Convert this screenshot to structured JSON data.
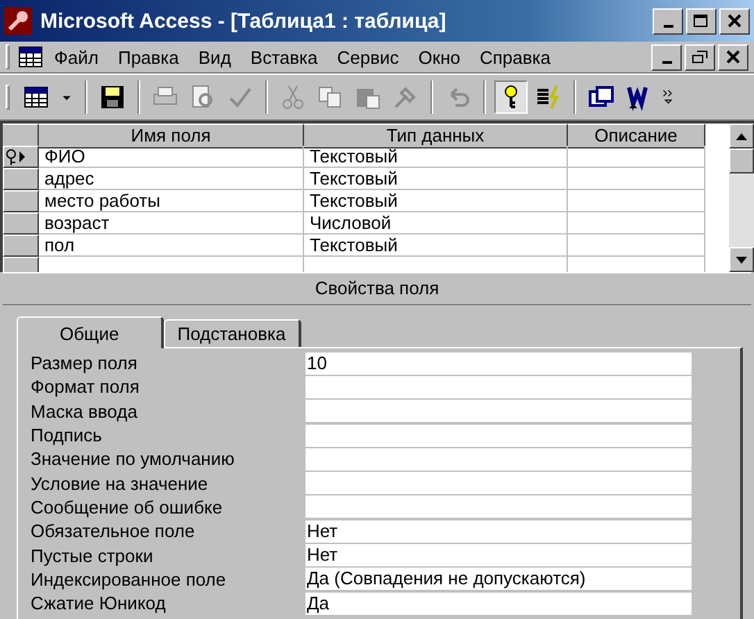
{
  "window": {
    "title": "Microsoft Access - [Таблица1 : таблица]"
  },
  "menu": [
    {
      "label": "Файл"
    },
    {
      "label": "Правка"
    },
    {
      "label": "Вид"
    },
    {
      "label": "Вставка"
    },
    {
      "label": "Сервис"
    },
    {
      "label": "Окно"
    },
    {
      "label": "Справка"
    }
  ],
  "toolbar": [
    {
      "kind": "view",
      "disabled": false,
      "pressed": false
    },
    {
      "kind": "dropdown",
      "disabled": false,
      "pressed": false
    },
    {
      "kind": "sep"
    },
    {
      "kind": "save",
      "disabled": false,
      "pressed": false
    },
    {
      "kind": "sep"
    },
    {
      "kind": "print",
      "disabled": true,
      "pressed": false
    },
    {
      "kind": "preview",
      "disabled": true,
      "pressed": false
    },
    {
      "kind": "spell",
      "disabled": true,
      "pressed": false
    },
    {
      "kind": "sep"
    },
    {
      "kind": "cut",
      "disabled": true,
      "pressed": false
    },
    {
      "kind": "copy",
      "disabled": true,
      "pressed": false
    },
    {
      "kind": "paste",
      "disabled": true,
      "pressed": false
    },
    {
      "kind": "painter",
      "disabled": true,
      "pressed": false
    },
    {
      "kind": "sep"
    },
    {
      "kind": "undo",
      "disabled": true,
      "pressed": false
    },
    {
      "kind": "sep"
    },
    {
      "kind": "key",
      "disabled": false,
      "pressed": true
    },
    {
      "kind": "indexes",
      "disabled": false,
      "pressed": false
    },
    {
      "kind": "sep"
    },
    {
      "kind": "newobject",
      "disabled": false,
      "pressed": false
    },
    {
      "kind": "word",
      "disabled": false,
      "pressed": false
    },
    {
      "kind": "more",
      "disabled": false,
      "pressed": false
    }
  ],
  "table": {
    "columns": [
      "Имя поля",
      "Тип данных",
      "Описание"
    ],
    "rows": [
      {
        "name": "ФИО",
        "type": "Текстовый",
        "key": true,
        "current": true
      },
      {
        "name": "адрес",
        "type": "Текстовый",
        "key": false,
        "current": false
      },
      {
        "name": "место работы",
        "type": "Текстовый",
        "key": false,
        "current": false
      },
      {
        "name": "возраст",
        "type": "Числовой",
        "key": false,
        "current": false
      },
      {
        "name": "пол",
        "type": "Текстовый",
        "key": false,
        "current": false
      }
    ]
  },
  "properties": {
    "title": "Свойства поля",
    "tabs": [
      {
        "label": "Общие",
        "selected": true
      },
      {
        "label": "Подстановка",
        "selected": false
      }
    ],
    "rows": [
      {
        "label": "Размер поля",
        "value": "10"
      },
      {
        "label": "Формат поля"
      },
      {
        "label": "Маска ввода"
      },
      {
        "label": "Подпись"
      },
      {
        "label": "Значение по умолчанию"
      },
      {
        "label": "Условие на значение"
      },
      {
        "label": "Сообщение об ошибке"
      },
      {
        "label": "Обязательное поле",
        "value": "Нет"
      },
      {
        "label": "Пустые строки",
        "value": "Нет"
      },
      {
        "label": "Индексированное поле",
        "value": "Да (Совпадения не допускаются)"
      },
      {
        "label": "Сжатие Юникод",
        "value": "Да"
      }
    ]
  }
}
